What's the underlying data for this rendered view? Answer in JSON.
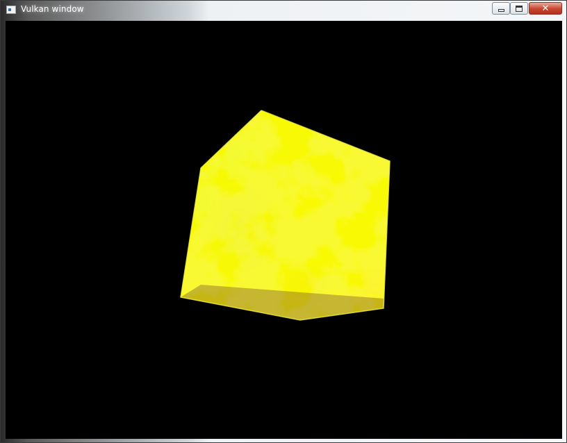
{
  "window": {
    "title": "Vulkan window",
    "controls": {
      "minimize_icon": "minimize-icon",
      "maximize_icon": "maximize-icon",
      "close_icon": "close-icon",
      "close_glyph": "✕"
    },
    "colors": {
      "client_background": "#000000",
      "close_button": "#c7452f"
    }
  },
  "scene": {
    "object": "textured-cube",
    "texture_colors": [
      "#ffff00",
      "#2a9a3a",
      "#2a4aa8",
      "#6a2aa0",
      "#b03018"
    ]
  }
}
